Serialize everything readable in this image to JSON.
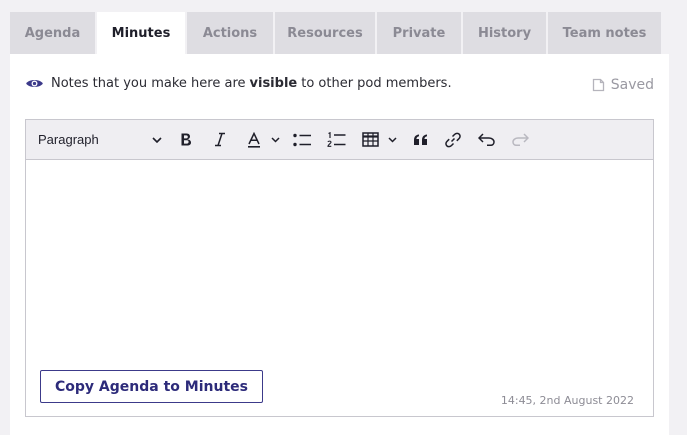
{
  "tabs": [
    {
      "label": "Agenda",
      "active": false
    },
    {
      "label": "Minutes",
      "active": true
    },
    {
      "label": "Actions",
      "active": false
    },
    {
      "label": "Resources",
      "active": false
    },
    {
      "label": "Private",
      "active": false
    },
    {
      "label": "History",
      "active": false
    },
    {
      "label": "Team notes",
      "active": false
    }
  ],
  "notice": {
    "prefix": "Notes that you make here are",
    "emphasis": "visible",
    "suffix": "to other pod members."
  },
  "status": {
    "saved_label": "Saved"
  },
  "editor": {
    "block_format": "Paragraph",
    "content": "",
    "copy_button": "Copy Agenda to Minutes",
    "timestamp": "14:45, 2nd August 2022"
  },
  "colors": {
    "accent": "#3c3a8a",
    "tab_inactive_bg": "#dedde2",
    "toolbar_bg": "#efeef2",
    "page_bg": "#f2f1f4"
  },
  "icons": {
    "notice": "eye-icon",
    "saved": "document-icon"
  }
}
